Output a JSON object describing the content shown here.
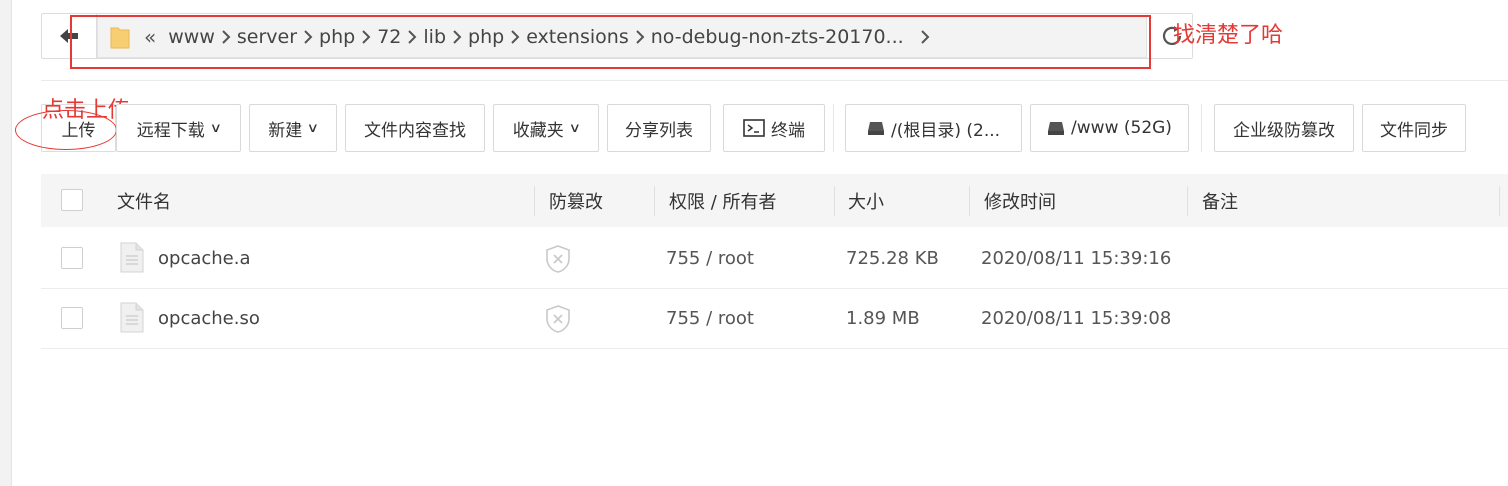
{
  "breadcrumb": {
    "items": [
      "www",
      "server",
      "php",
      "72",
      "lib",
      "php",
      "extensions",
      "no-debug-non-zts-20170..."
    ]
  },
  "annotations": {
    "path_note": "找清楚了哈",
    "upload_note": "点击上传"
  },
  "toolbar": {
    "upload": "上传",
    "remote_download": "远程下载",
    "new": "新建",
    "content_search": "文件内容查找",
    "favorites": "收藏夹",
    "share_list": "分享列表",
    "terminal": "终端",
    "disk_root": "/(根目录) (2...",
    "disk_www": "/www (52G)",
    "tamper_proof": "企业级防篡改",
    "file_sync": "文件同步"
  },
  "table": {
    "columns": [
      "文件名",
      "防篡改",
      "权限 / 所有者",
      "大小",
      "修改时间",
      "备注"
    ],
    "rows": [
      {
        "name": "opcache.a",
        "perm": "755 / root",
        "size": "725.28 KB",
        "mtime": "2020/08/11 15:39:16",
        "note": ""
      },
      {
        "name": "opcache.so",
        "perm": "755 / root",
        "size": "1.89 MB",
        "mtime": "2020/08/11 15:39:08",
        "note": ""
      }
    ]
  },
  "colors": {
    "annotation_red": "#e53935",
    "folder_yellow": "#f7cf72"
  }
}
